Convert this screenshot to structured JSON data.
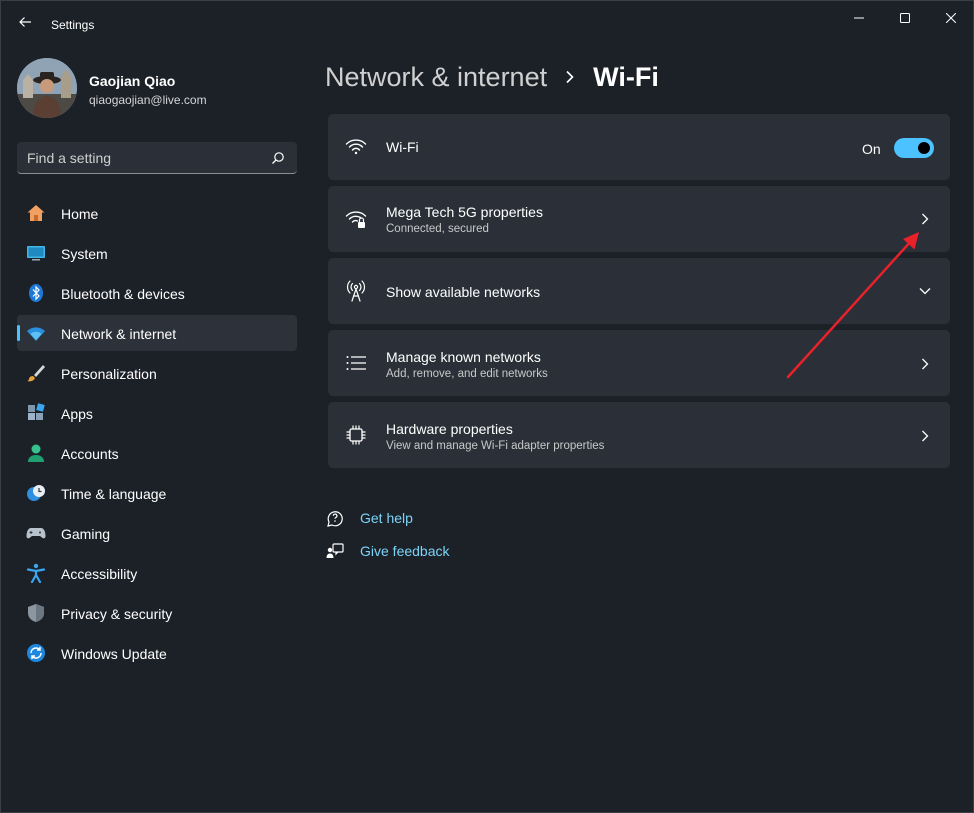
{
  "window": {
    "title": "Settings",
    "back_icon": "back-arrow-icon",
    "controls": [
      "minimize-icon",
      "maximize-icon",
      "close-icon"
    ]
  },
  "profile": {
    "name": "Gaojian Qiao",
    "email": "qiaogaojian@live.com"
  },
  "search": {
    "placeholder": "Find a setting",
    "icon": "search-icon"
  },
  "sidebar": {
    "items": [
      {
        "label": "Home",
        "icon": "home-icon"
      },
      {
        "label": "System",
        "icon": "system-icon"
      },
      {
        "label": "Bluetooth & devices",
        "icon": "bluetooth-icon"
      },
      {
        "label": "Network & internet",
        "icon": "network-icon",
        "active": true
      },
      {
        "label": "Personalization",
        "icon": "brush-icon"
      },
      {
        "label": "Apps",
        "icon": "apps-icon"
      },
      {
        "label": "Accounts",
        "icon": "accounts-icon"
      },
      {
        "label": "Time & language",
        "icon": "clock-globe-icon"
      },
      {
        "label": "Gaming",
        "icon": "gamepad-icon"
      },
      {
        "label": "Accessibility",
        "icon": "accessibility-icon"
      },
      {
        "label": "Privacy & security",
        "icon": "shield-icon"
      },
      {
        "label": "Windows Update",
        "icon": "update-icon"
      }
    ]
  },
  "header": {
    "parent": "Network & internet",
    "current": "Wi-Fi"
  },
  "main": {
    "wifi": {
      "label": "Wi-Fi",
      "state_label": "On",
      "enabled": true
    },
    "connection": {
      "title": "Mega Tech 5G properties",
      "subtitle": "Connected, secured"
    },
    "available": {
      "title": "Show available networks"
    },
    "known": {
      "title": "Manage known networks",
      "subtitle": "Add, remove, and edit networks"
    },
    "hardware": {
      "title": "Hardware properties",
      "subtitle": "View and manage Wi-Fi adapter properties"
    }
  },
  "links": {
    "help": "Get help",
    "feedback": "Give feedback"
  },
  "colors": {
    "accent": "#4cc2ff",
    "link": "#7dd3f7",
    "background": "#1c2128",
    "card": "#2b3038",
    "annotation_arrow": "#e8212a"
  }
}
